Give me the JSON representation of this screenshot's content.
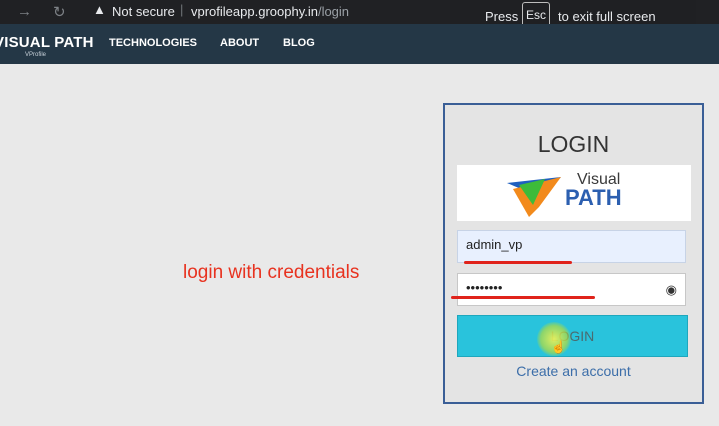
{
  "browser": {
    "back_icon": "arrow-right-icon",
    "reload_icon": "reload-icon",
    "security_label": "Not secure",
    "separator": "|",
    "url_host": "vprofileapp.groophy.in",
    "url_path": "/login"
  },
  "fullscreen_notice": {
    "prefix": "Press",
    "key": "Esc",
    "suffix": "to exit full screen"
  },
  "site_nav": {
    "brand": "VISUAL PATH",
    "brand_sub": "VProfile",
    "links": [
      "TECHNOLOGIES",
      "ABOUT",
      "BLOG"
    ]
  },
  "annotation_text": "login with credentials",
  "login": {
    "title": "LOGIN",
    "logo_text_top": "Visual",
    "logo_text_bottom": "PATH",
    "username_value": "admin_vp",
    "password_value": "••••••••",
    "button_label": "LOGIN",
    "create_account_label": "Create an account"
  },
  "colors": {
    "nav_bg": "#243746",
    "button_bg": "#29c3dc",
    "annotation_red": "#e8321f",
    "card_border": "#3a5e96"
  }
}
